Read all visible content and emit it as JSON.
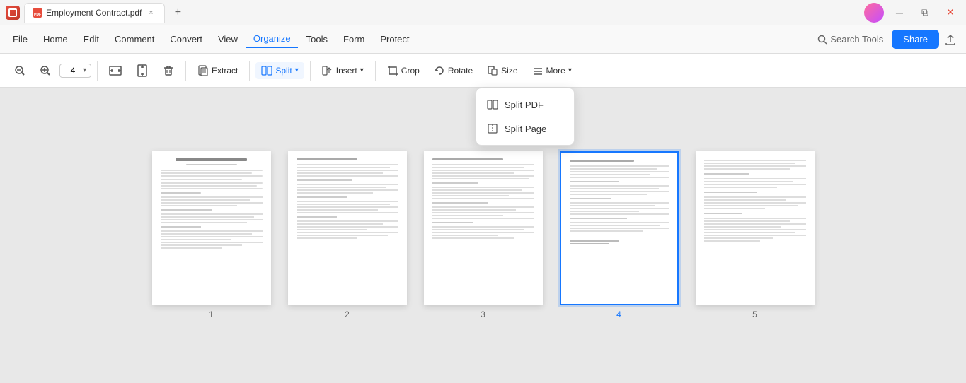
{
  "titleBar": {
    "appIcon": "pdf-icon",
    "tabLabel": "Employment Contract.pdf",
    "closeTab": "×",
    "newTab": "+",
    "windowControls": [
      "minimize",
      "restore",
      "close"
    ]
  },
  "menuBar": {
    "items": [
      {
        "id": "file",
        "label": "File"
      },
      {
        "id": "home",
        "label": "Home"
      },
      {
        "id": "edit",
        "label": "Edit"
      },
      {
        "id": "comment",
        "label": "Comment"
      },
      {
        "id": "convert",
        "label": "Convert"
      },
      {
        "id": "view",
        "label": "View"
      },
      {
        "id": "organize",
        "label": "Organize",
        "active": true
      },
      {
        "id": "tools",
        "label": "Tools"
      },
      {
        "id": "form",
        "label": "Form"
      },
      {
        "id": "protect",
        "label": "Protect"
      }
    ],
    "searchTools": "Search Tools",
    "shareLabel": "Share"
  },
  "toolbar": {
    "zoomOut": "zoom-out",
    "zoomIn": "zoom-in",
    "zoomValue": "4",
    "tools": [
      {
        "id": "fit-width",
        "label": "",
        "icon": "fit-width-icon"
      },
      {
        "id": "fit-page",
        "label": "",
        "icon": "fit-page-icon"
      },
      {
        "id": "delete",
        "label": "",
        "icon": "trash-icon"
      }
    ],
    "extract": "Extract",
    "split": "Split",
    "splitDropdown": true,
    "insert": "Insert",
    "crop": "Crop",
    "rotate": "Rotate",
    "size": "Size",
    "more": "More"
  },
  "splitMenu": {
    "items": [
      {
        "id": "split-pdf",
        "label": "Split PDF",
        "icon": "split-pdf-icon"
      },
      {
        "id": "split-page",
        "label": "Split Page",
        "icon": "split-page-icon"
      }
    ]
  },
  "pages": [
    {
      "num": "1",
      "selected": false
    },
    {
      "num": "2",
      "selected": false
    },
    {
      "num": "3",
      "selected": false
    },
    {
      "num": "4",
      "selected": true
    },
    {
      "num": "5",
      "selected": false
    }
  ],
  "colors": {
    "accent": "#1677ff",
    "selectedBorder": "#1677ff"
  }
}
